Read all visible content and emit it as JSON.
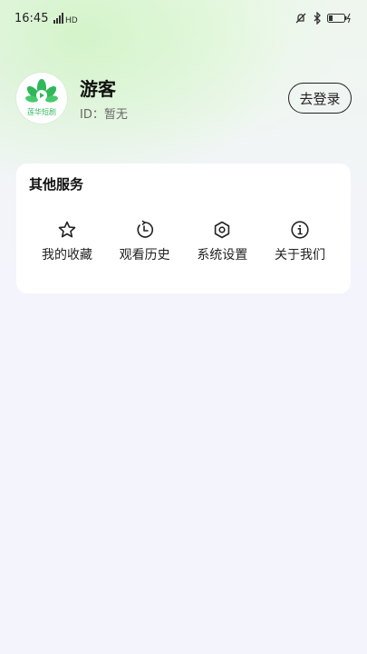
{
  "status_bar": {
    "time": "16:45",
    "signal": "ᴴᴰ"
  },
  "profile": {
    "avatar_text": "莲华短剧",
    "name": "游客",
    "id_text": "ID：暂无",
    "login_label": "去登录"
  },
  "services": {
    "title": "其他服务",
    "items": [
      {
        "label": "我的收藏",
        "icon": "star-icon"
      },
      {
        "label": "观看历史",
        "icon": "history-icon"
      },
      {
        "label": "系统设置",
        "icon": "settings-icon"
      },
      {
        "label": "关于我们",
        "icon": "info-icon"
      }
    ]
  },
  "colors": {
    "brand_green": "#2fb85a",
    "background": "#f4f4fc"
  }
}
